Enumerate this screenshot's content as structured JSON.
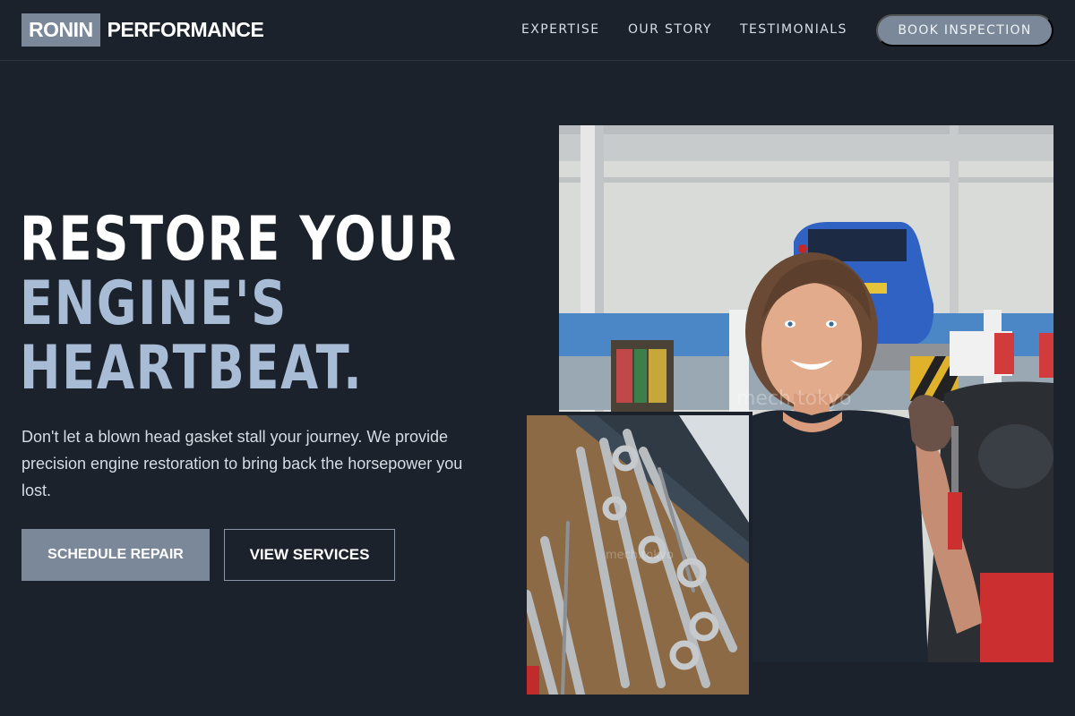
{
  "brand": {
    "logo_box": "RONIN",
    "logo_rest": "PERFORMANCE"
  },
  "nav": {
    "links": [
      "EXPERTISE",
      "OUR STORY",
      "TESTIMONIALS"
    ],
    "cta": "BOOK INSPECTION"
  },
  "hero": {
    "headline_line1": "RESTORE YOUR",
    "headline_line2": "ENGINE'S",
    "headline_line3": "HEARTBEAT.",
    "lede": "Don't let a blown head gasket stall your journey. We provide precision engine restoration to bring back the horsepower you lost.",
    "primary_button": "SCHEDULE REPAIR",
    "secondary_button": "VIEW SERVICES"
  },
  "images": {
    "garage_watermark": "mech.tokyo",
    "tools_watermark": "mech.tokyo"
  },
  "colors": {
    "background": "#1b222b",
    "accent": "#7b889a",
    "headline_blue": "#a9bcd6"
  }
}
